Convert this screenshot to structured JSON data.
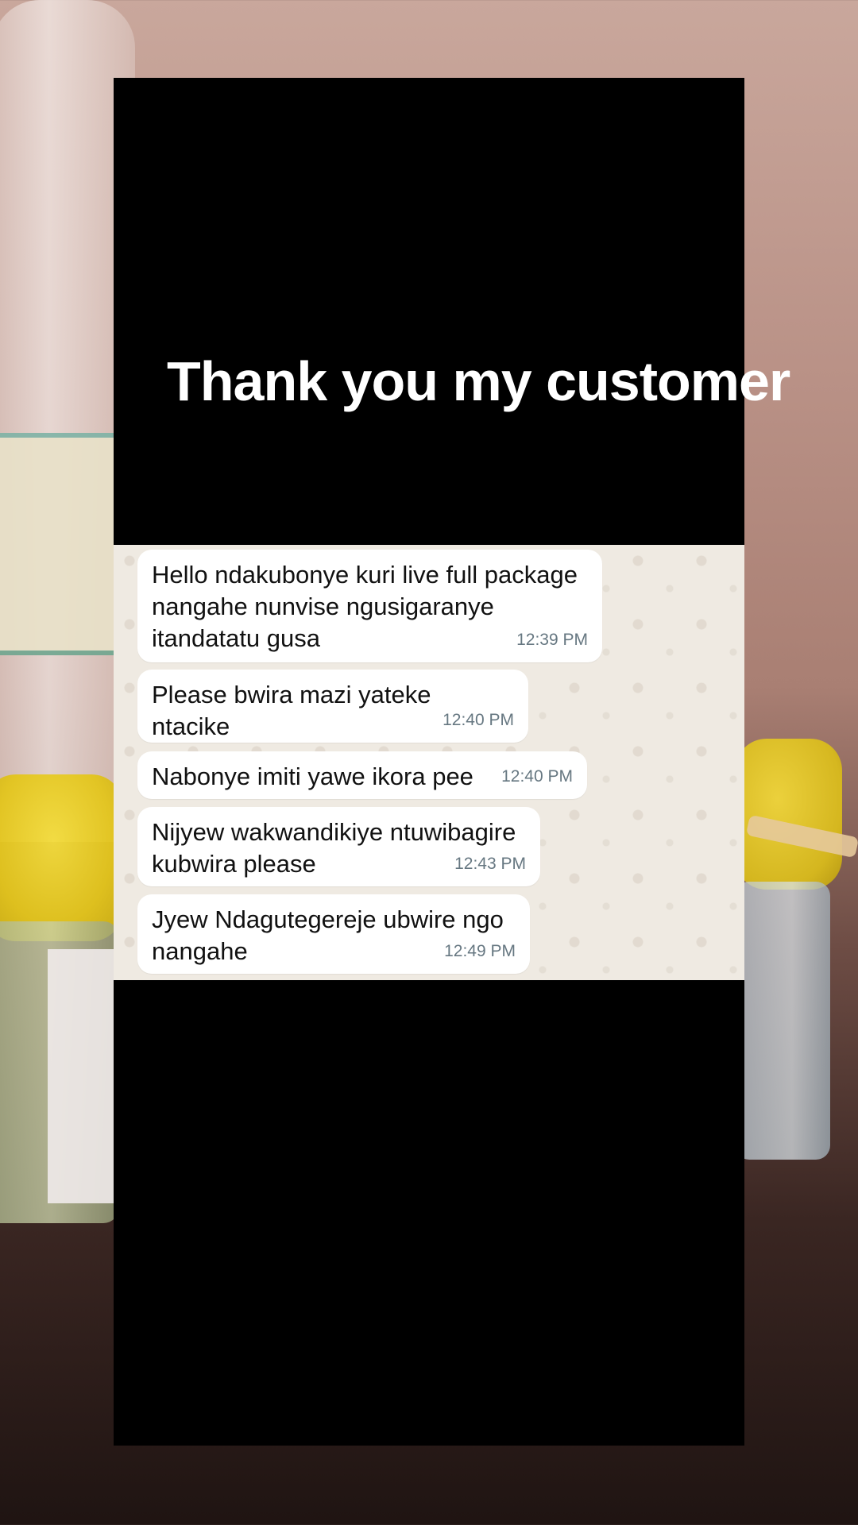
{
  "headline": "Thank you my customer",
  "messages": [
    {
      "text": "Hello ndakubonye kuri live full package\nnangahe nunvise ngusigaranye\nitandatatu gusa",
      "time": "12:39 PM"
    },
    {
      "text": "Please bwira mazi yateke ntacike",
      "time": "12:40 PM"
    },
    {
      "text": "Nabonye imiti yawe ikora pee",
      "time": "12:40 PM"
    },
    {
      "text": "Nijyew wakwandikiye ntuwibagire\nkubwira please",
      "time": "12:43 PM"
    },
    {
      "text": "Jyew Ndagutegereje ubwire ngo\nnangahe",
      "time": "12:49 PM"
    }
  ],
  "colors": {
    "card": "#000000",
    "chat_background": "#efeae2",
    "bubble": "#ffffff",
    "timestamp": "#667781"
  }
}
